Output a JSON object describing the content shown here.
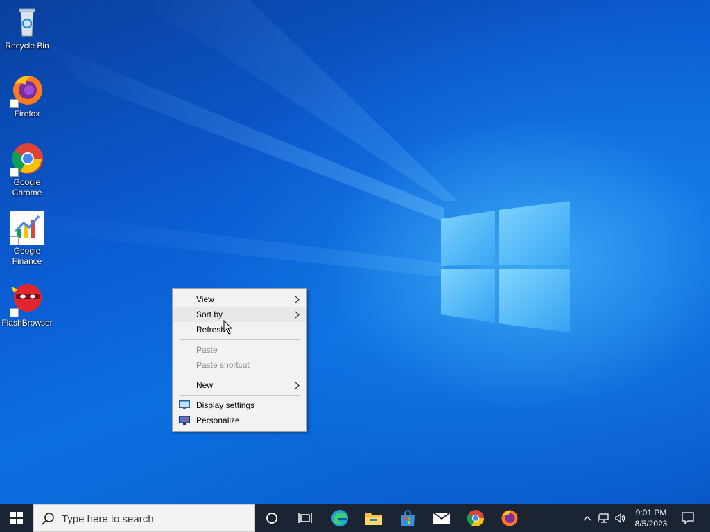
{
  "desktop": {
    "icons": [
      {
        "label": "Recycle Bin",
        "icon": "recycle-bin-icon"
      },
      {
        "label": "Firefox",
        "icon": "firefox-icon"
      },
      {
        "label": "Google Chrome",
        "icon": "chrome-icon"
      },
      {
        "label": "Google Finance",
        "icon": "google-finance-icon"
      },
      {
        "label": "FlashBrowser",
        "icon": "flashbrowser-icon"
      }
    ]
  },
  "context_menu": {
    "items": [
      {
        "label": "View",
        "submenu": true
      },
      {
        "label": "Sort by",
        "submenu": true,
        "highlighted": true
      },
      {
        "label": "Refresh"
      },
      {
        "label": "Paste",
        "disabled": true
      },
      {
        "label": "Paste shortcut",
        "disabled": true
      },
      {
        "label": "New",
        "submenu": true
      },
      {
        "label": "Display settings",
        "icon": "display-settings-icon"
      },
      {
        "label": "Personalize",
        "icon": "personalize-icon"
      }
    ]
  },
  "taskbar": {
    "search_placeholder": "Type here to search",
    "pinned": [
      "cortana-icon",
      "task-view-icon",
      "edge-icon",
      "file-explorer-icon",
      "microsoft-store-icon",
      "mail-icon",
      "chrome-icon",
      "firefox-icon"
    ],
    "tray": [
      "show-hidden-icons-chevron",
      "network-icon",
      "volume-icon"
    ],
    "clock_time": "9:01 PM",
    "clock_date": "8/5/2023"
  },
  "colors": {
    "taskbar_bg": "#1a2433",
    "menu_bg": "#f2f2f2",
    "menu_highlight": "#e8e8e8",
    "desktop_blue": "#0b5ad0"
  }
}
